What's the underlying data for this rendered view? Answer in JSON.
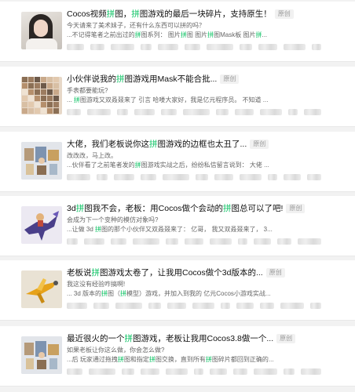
{
  "articles": [
    {
      "title": [
        "Cocos视频",
        "拼",
        "图，",
        "拼",
        "图游戏的最后一块碎片，支持原生！"
      ],
      "badge": "原创",
      "subtitle": "今天请来了美术妹子，还有什么东西可以拼的吗？",
      "excerpt": [
        "...不记得笔者之前出过的",
        "拼",
        "图系列：  图片",
        "拼",
        "图 图片",
        "拼",
        "图Mask板 图片",
        "拼",
        "..."
      ],
      "thumb_icon": "girl-portrait-thumbnail"
    },
    {
      "title": [
        "小伙伴说我的",
        "拼",
        "图游戏用Mask不能合批..."
      ],
      "badge": "原创",
      "subtitle": "手表都要能玩?",
      "excerpt": [
        "... ",
        "拼",
        "图游戏又双叒叕来了 引言 哈喽大家好，我是亿元程序员。 不知道 ..."
      ],
      "thumb_icon": "tile-grid-thumbnail"
    },
    {
      "title": [
        "大佬，我们老板说你这",
        "拼",
        "图游戏的边框也太丑了..."
      ],
      "badge": "原创",
      "subtitle": "改改改，马上改。",
      "excerpt": [
        "...伙伴看了之前笔者发的",
        "拼",
        "图游戏实战之后，纷纷私信留言说到： 大佬 ..."
      ],
      "thumb_icon": "pixel-scene-thumbnail"
    },
    {
      "title": [
        "3d",
        "拼",
        "图我不会，老板：用Cocos做个会动的",
        "拼",
        "图总可以了吧!"
      ],
      "badge": "原创",
      "subtitle": "会成为下一个变种的模仿对象吗?",
      "excerpt": [
        "...让做 3d ",
        "拼",
        "图的那个小伙伴又双叒叕来了：  亿哥， 我又双叒叕来了， 3..."
      ],
      "thumb_icon": "dragon-rider-thumbnail"
    },
    {
      "title": [
        "老板说",
        "拼",
        "图游戏太卷了，让我用Cocos做个3d版本的..."
      ],
      "badge": "原创",
      "subtitle": "我这没有经验咋搞啊!",
      "excerpt": [
        "... 3d 版本的",
        "拼",
        "图（",
        "拼",
        "模型）游戏，并加入到我的 亿元Cocos小游戏实战..."
      ],
      "thumb_icon": "airplane-thumbnail"
    },
    {
      "title": [
        "最近很火的一个",
        "拼",
        "图游戏，老板让我用Cocos3.8做一个..."
      ],
      "badge": "原创",
      "subtitle": "如果老板让你这么做，你会怎么做?",
      "excerpt": [
        "...后 玩家通过拖拽",
        "拼",
        "图和指定",
        "拼",
        "图交换，直到所有",
        "拼",
        "图碎片都回到正确的..."
      ],
      "thumb_icon": "pixel-scene-thumbnail"
    }
  ],
  "colors": {
    "highlight": "#07c160",
    "badge_bg": "#f1f1f1",
    "badge_text": "#999999"
  }
}
